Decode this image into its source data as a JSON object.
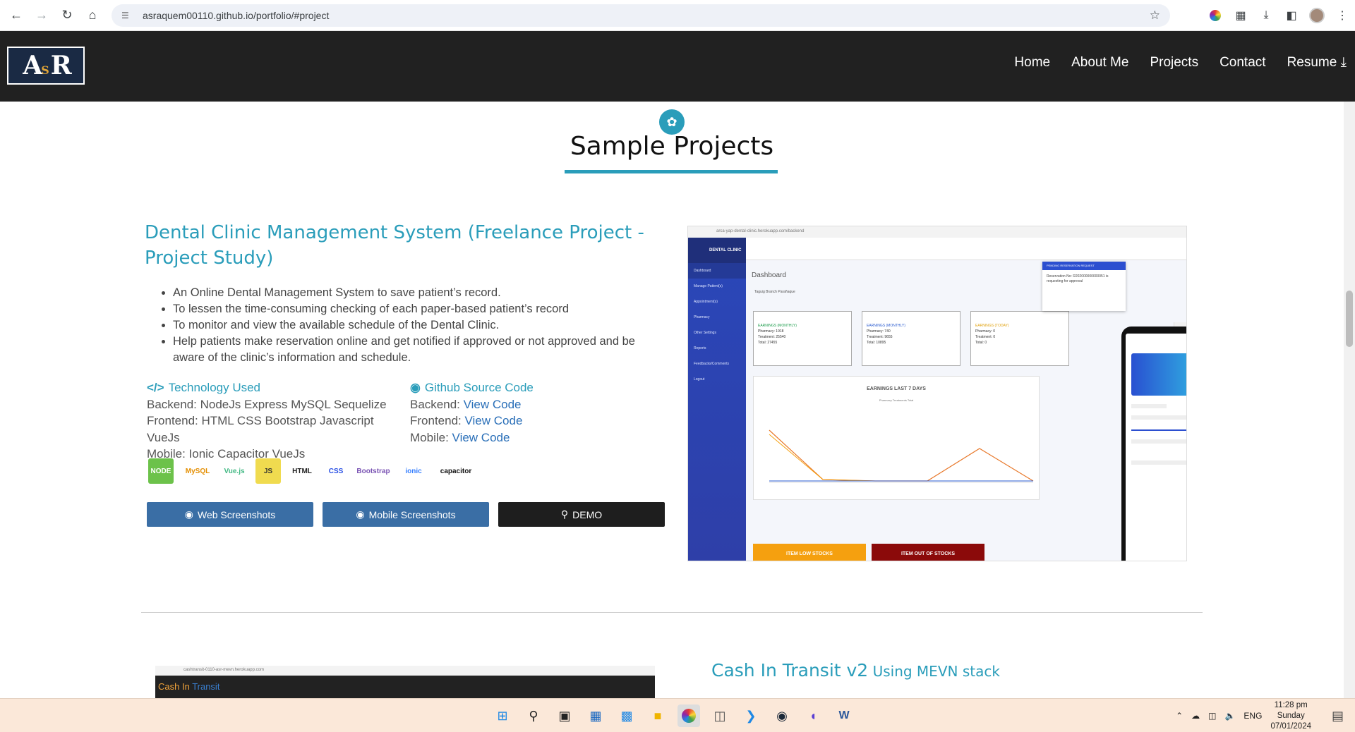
{
  "browser": {
    "url": "asraquem00110.github.io/portfolio/#project"
  },
  "site": {
    "logo_text": "ASR",
    "nav": [
      "Home",
      "About Me",
      "Projects",
      "Contact"
    ],
    "resume_label": "Resume"
  },
  "section": {
    "title": "Sample Projects"
  },
  "project1": {
    "title": "Dental Clinic Management System (Freelance Project - Project Study)",
    "bullets": [
      "An Online Dental Management System to save patient’s record.",
      "To lessen the time-consuming checking of each paper-based patient’s record",
      "To monitor and view the available schedule of the Dental Clinic.",
      "Help patients make reservation online and get notified if approved or not approved and be aware of the clinic’s information and schedule."
    ],
    "tech_heading": "Technology Used",
    "tech_backend": "Backend: NodeJs Express MySQL Sequelize",
    "tech_frontend": "Frontend: HTML CSS Bootstrap Javascript VueJs",
    "tech_mobile": "Mobile: Ionic Capacitor VueJs",
    "github_heading": "Github Source Code",
    "gh_backend_label": "Backend: ",
    "gh_frontend_label": "Frontend: ",
    "gh_mobile_label": "Mobile: ",
    "view_code": "View Code",
    "tech_logos": [
      "NODE",
      "MySQL",
      "Vue.js",
      "JS",
      "HTML",
      "CSS",
      "Bootstrap",
      "ionic",
      "capacitor"
    ],
    "buttons": {
      "web": "Web Screenshots",
      "mobile": "Mobile Screenshots",
      "demo": "DEMO"
    }
  },
  "screenshot1": {
    "url": "arca-yap-dental-clinic.herokuapp.com/backend",
    "brand": "DENTAL CLINIC",
    "sidebar": [
      "Dashboard",
      "Manage Patient(s)",
      "Appointment(s)",
      "Pharmacy",
      "Other Settings",
      "Reports",
      "Feedbacks/Comments",
      "Logout"
    ],
    "dashboard_title": "Dashboard",
    "tabs": "Taguig Branch     Parañaque",
    "cards": [
      {
        "label": "EARNINGS (MONTHLY)",
        "lines": [
          "Pharmacy: 1918",
          "Treatment: 25540",
          "Total: 27455"
        ]
      },
      {
        "label": "EARNINGS (MONTHLY)",
        "lines": [
          "Pharmacy: 740",
          "Treatment: 9655",
          "Total: 10895"
        ]
      },
      {
        "label": "EARNINGS (TODAY)",
        "lines": [
          "Pharmacy: 0",
          "Treatment: 0",
          "Total: 0"
        ]
      }
    ],
    "chart_title": "EARNINGS LAST 7 DAYS",
    "chart_legend": "Pharmacy   Treatments   Total",
    "banner_low": "ITEM LOW STOCKS",
    "banner_out": "ITEM OUT OF STOCKS",
    "notif_head": "PENDING RESERVATION REQUEST",
    "notif_text": "Reservation No: R202000000000051 is requesting for approval",
    "colors": {
      "sidebar": "#2a47b9",
      "low": "#f5a00f",
      "out": "#8b0a0a"
    }
  },
  "project2": {
    "title": "Cash In Transit v2",
    "subtitle": " Using MEVN stack",
    "shot_url": "cashtransit-0110-asr-mevn.herokuapp.com",
    "shot_brand_a": "Cash In ",
    "shot_brand_b": "Transit"
  },
  "taskbar": {
    "lang": "ENG",
    "time": "11:28 pm",
    "day": "Sunday",
    "date": "07/01/2024"
  }
}
